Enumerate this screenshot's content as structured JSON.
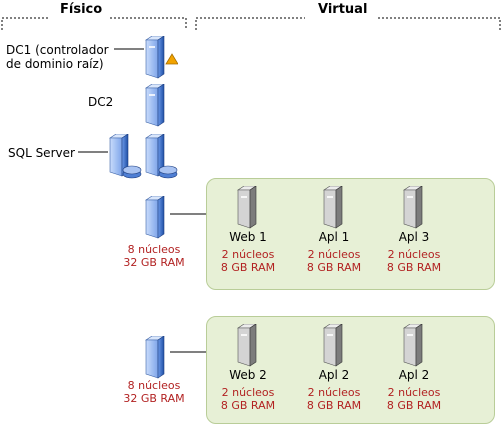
{
  "headers": {
    "physical": "Físico",
    "virtual": "Virtual"
  },
  "physical": {
    "dc1_label_line1": "DC1 (controlador",
    "dc1_label_line2": "de dominio raíz)",
    "dc2_label": "DC2",
    "sql_label": "SQL Server",
    "host1_spec_line1": "8 núcleos",
    "host1_spec_line2": "32 GB RAM",
    "host2_spec_line1": "8 núcleos",
    "host2_spec_line2": "32 GB RAM"
  },
  "virtual": {
    "group1": [
      {
        "name": "Web 1",
        "cores": "2 núcleos",
        "ram": "8 GB RAM"
      },
      {
        "name": "Apl 1",
        "cores": "2 núcleos",
        "ram": "8 GB RAM"
      },
      {
        "name": "Apl 3",
        "cores": "2 núcleos",
        "ram": "8 GB RAM"
      }
    ],
    "group2": [
      {
        "name": "Web 2",
        "cores": "2 núcleos",
        "ram": "8 GB RAM"
      },
      {
        "name": "Apl 2",
        "cores": "2 núcleos",
        "ram": "8 GB RAM"
      },
      {
        "name": "Apl 2",
        "cores": "2 núcleos",
        "ram": "8 GB RAM"
      }
    ]
  },
  "colors": {
    "spec_text": "#b22222",
    "panel_fill": "#e7f0d6",
    "panel_border": "#b9cd98",
    "server_blue": "#2f5fb3"
  }
}
